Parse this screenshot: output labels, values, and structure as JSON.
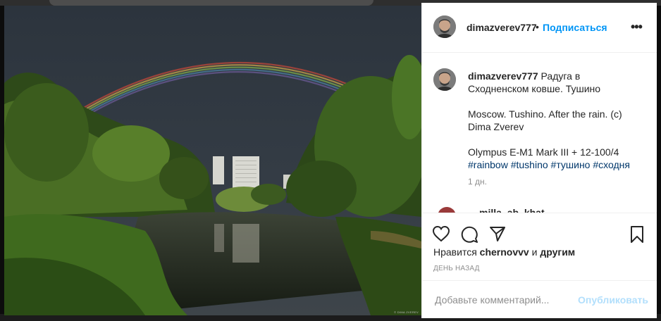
{
  "post": {
    "username": "dimazverev777",
    "follow_label": "Подписаться",
    "separator": "•",
    "more_label": "•••",
    "photo_watermark": "© DIMA ZVEREV",
    "caption": {
      "username": "dimazverev777",
      "line1": "Радуга в Сходненском ковше. Тушино",
      "line2": "Moscow. Tushino. After the rain. (c) Dima Zverev",
      "line3": "Olympus E-M1 Mark III + 12-100/4",
      "hashtags": [
        "#rainbow",
        "#tushino",
        "#тушино",
        "#сходня"
      ],
      "time": "1 дн."
    },
    "next_comment_preview": "milla_ab_khat...",
    "likes": {
      "prefix": "Нравится",
      "user": "chernovvv",
      "and": "и",
      "others": "другим"
    },
    "date_label": "ДЕНЬ НАЗАД",
    "comment_placeholder": "Добавьте комментарий...",
    "publish_label": "Опубликовать"
  },
  "icons": {
    "like": "heart-icon",
    "comment": "comment-icon",
    "share": "paper-plane-icon",
    "save": "bookmark-icon",
    "more": "more-dots-icon"
  },
  "colors": {
    "link_blue": "#0095f6",
    "hashtag": "#00376b",
    "muted": "#8e8e8e",
    "publish_disabled": "#b2dffc"
  }
}
